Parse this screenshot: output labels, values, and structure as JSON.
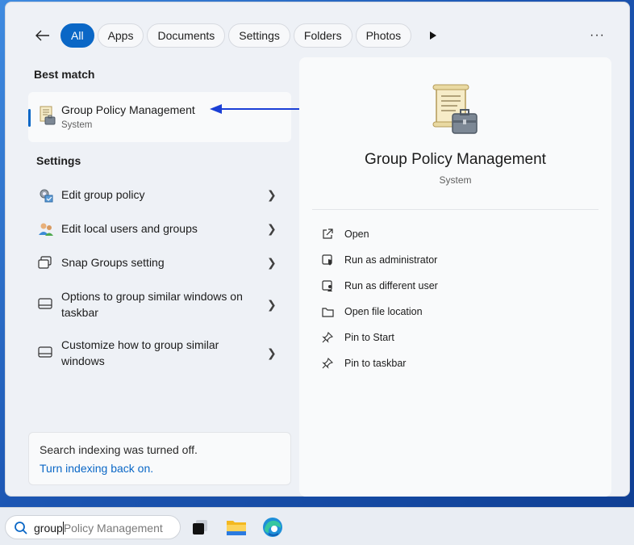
{
  "filters": {
    "tabs": [
      {
        "label": "All",
        "active": true
      },
      {
        "label": "Apps"
      },
      {
        "label": "Documents"
      },
      {
        "label": "Settings"
      },
      {
        "label": "Folders"
      },
      {
        "label": "Photos"
      }
    ],
    "more_label": "···"
  },
  "best_match": {
    "heading": "Best match",
    "title": "Group Policy Management",
    "subtitle": "System"
  },
  "settings": {
    "heading": "Settings",
    "items": [
      {
        "label": "Edit group policy",
        "icon": "group-policy-icon"
      },
      {
        "label": "Edit local users and groups",
        "icon": "users-icon"
      },
      {
        "label": "Snap Groups setting",
        "icon": "snap-icon"
      },
      {
        "label": "Options to group similar windows on taskbar",
        "icon": "taskbar-icon"
      },
      {
        "label": "Customize how to group similar windows",
        "icon": "taskbar-icon"
      }
    ]
  },
  "indexing": {
    "message": "Search indexing was turned off.",
    "link": "Turn indexing back on."
  },
  "detail": {
    "title": "Group Policy Management",
    "subtitle": "System",
    "actions": [
      {
        "label": "Open",
        "icon": "open-external-icon"
      },
      {
        "label": "Run as administrator",
        "icon": "shield-window-icon"
      },
      {
        "label": "Run as different user",
        "icon": "user-window-icon"
      },
      {
        "label": "Open file location",
        "icon": "folder-icon"
      },
      {
        "label": "Pin to Start",
        "icon": "pin-icon"
      },
      {
        "label": "Pin to taskbar",
        "icon": "pin-icon"
      }
    ]
  },
  "taskbar": {
    "search_typed": "group",
    "search_suggestion": "Policy Management"
  },
  "colors": {
    "accent": "#0a67c6",
    "annotation_arrow": "#1a3fd6"
  }
}
